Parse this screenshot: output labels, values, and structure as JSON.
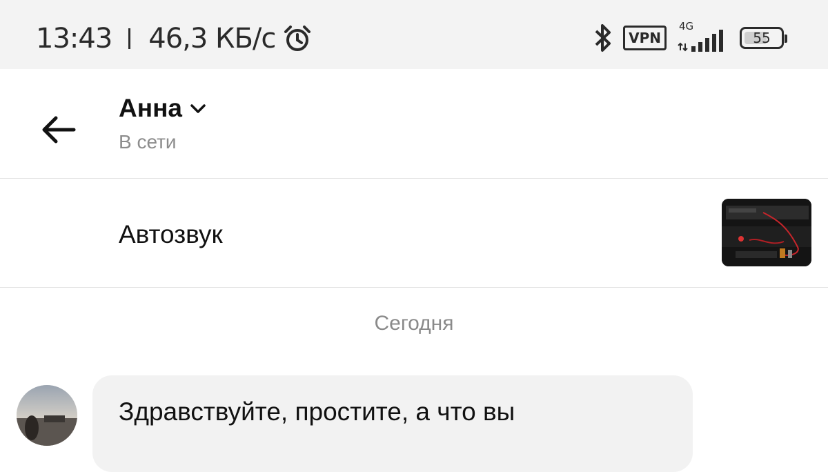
{
  "status_bar": {
    "time": "13:43",
    "network_speed": "46,3 КБ/с",
    "vpn_label": "VPN",
    "network_type": "4G",
    "battery_level": "55",
    "icons": [
      "alarm-icon",
      "bluetooth-icon",
      "vpn-icon",
      "signal-icon",
      "battery-icon"
    ]
  },
  "header": {
    "contact_name": "Анна",
    "contact_status": "В сети"
  },
  "item": {
    "title": "Автозвук"
  },
  "chat": {
    "date_divider": "Сегодня",
    "messages": [
      {
        "text": "Здравствуйте, простите, а что вы"
      }
    ]
  }
}
